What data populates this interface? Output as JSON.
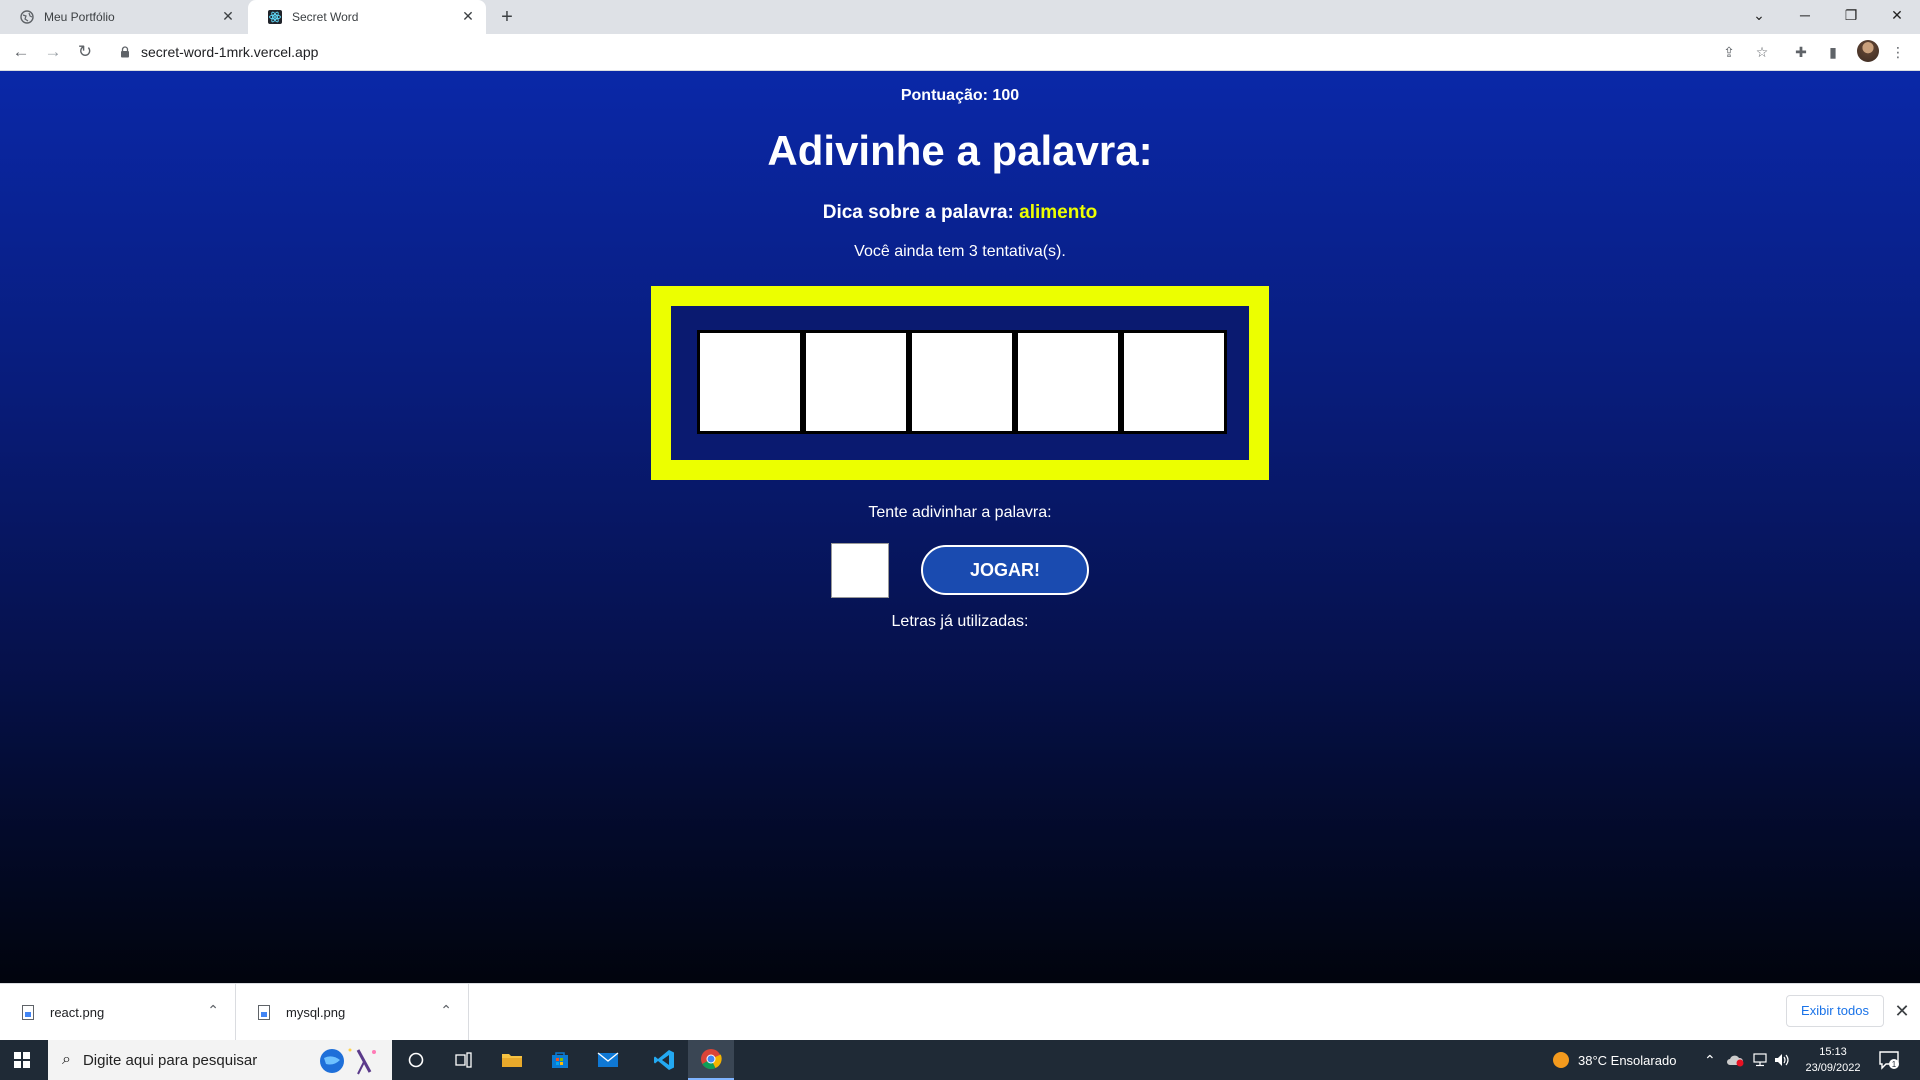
{
  "browser": {
    "tabs": [
      {
        "title": "Meu Portfólio",
        "active": false,
        "icon": "globe-icon"
      },
      {
        "title": "Secret Word",
        "active": true,
        "icon": "react-icon"
      }
    ],
    "url": "secret-word-1mrk.vercel.app"
  },
  "game": {
    "score_label": "Pontuação: 100",
    "title": "Adivinhe a palavra:",
    "tip_label": "Dica sobre a palavra:",
    "tip_value": "alimento",
    "attempts_text": "Você ainda tem 3 tentativa(s).",
    "letters": [
      "",
      "",
      "",
      "",
      ""
    ],
    "guess_label": "Tente adivinhar a palavra:",
    "guess_value": "",
    "play_label": "JOGAR!",
    "used_label": "Letras já utilizadas:",
    "colors": {
      "frame": "#ecff00",
      "hint": "#ecff00",
      "button": "#1a4bb0",
      "background_top": "#0a28a8",
      "background_bottom": "#01040d"
    }
  },
  "downloads": {
    "items": [
      {
        "name": "react.png",
        "icon": "image-file-icon"
      },
      {
        "name": "mysql.png",
        "icon": "image-file-icon"
      }
    ],
    "show_all_label": "Exibir todos"
  },
  "taskbar": {
    "search_placeholder": "Digite aqui para pesquisar",
    "weather": "38°C  Ensolarado",
    "time": "15:13",
    "date": "23/09/2022"
  }
}
